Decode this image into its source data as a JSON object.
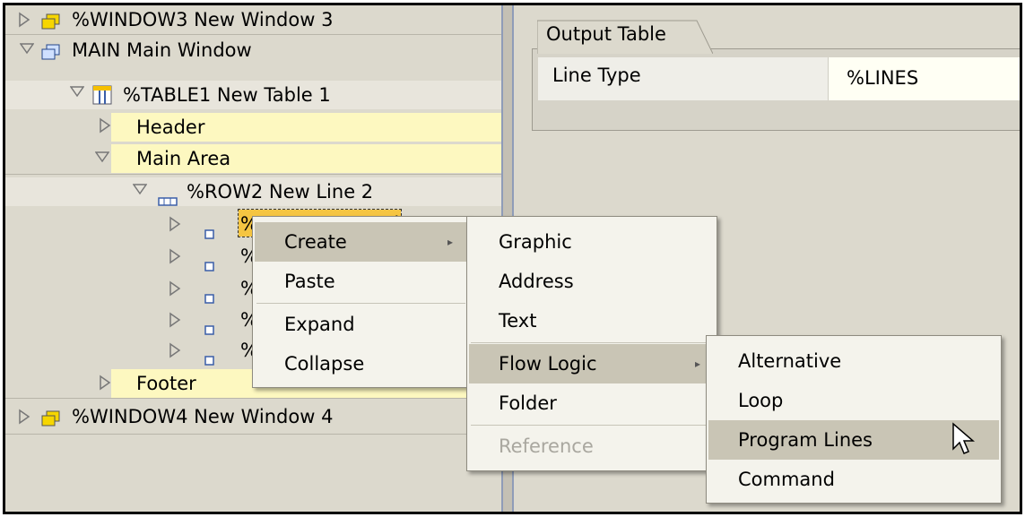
{
  "tree": {
    "nodes": [
      {
        "label": "%WINDOW3 New Window 3"
      },
      {
        "label": "MAIN Main Window"
      },
      {
        "label": "%TABLE1 New Table 1"
      },
      {
        "label": "Header"
      },
      {
        "label": "Main Area"
      },
      {
        "label": "%ROW2 New Line 2"
      },
      {
        "label": "%CELL6 New Cel"
      },
      {
        "label": "%"
      },
      {
        "label": "%"
      },
      {
        "label": "%"
      },
      {
        "label": "%"
      },
      {
        "label": "Footer"
      },
      {
        "label": "%WINDOW4 New Window 4"
      }
    ]
  },
  "details": {
    "tab_label": "Output Table",
    "field_label": "Line Type",
    "field_value": "%LINES"
  },
  "context_menu": {
    "items": [
      {
        "label": "Create"
      },
      {
        "label": "Paste"
      },
      {
        "label": "Expand"
      },
      {
        "label": "Collapse"
      }
    ]
  },
  "create_submenu": {
    "items": [
      {
        "label": "Graphic"
      },
      {
        "label": "Address"
      },
      {
        "label": "Text"
      },
      {
        "label": "Flow Logic"
      },
      {
        "label": "Folder"
      },
      {
        "label": "Reference"
      }
    ]
  },
  "flow_logic_submenu": {
    "items": [
      {
        "label": "Alternative"
      },
      {
        "label": "Loop"
      },
      {
        "label": "Program Lines"
      },
      {
        "label": "Command"
      }
    ]
  },
  "colors": {
    "background": "#dcd9cd",
    "highlight_row": "#fdf8c0",
    "menu_bg": "#f4f3ec",
    "menu_selected": "#c9c5b5"
  }
}
